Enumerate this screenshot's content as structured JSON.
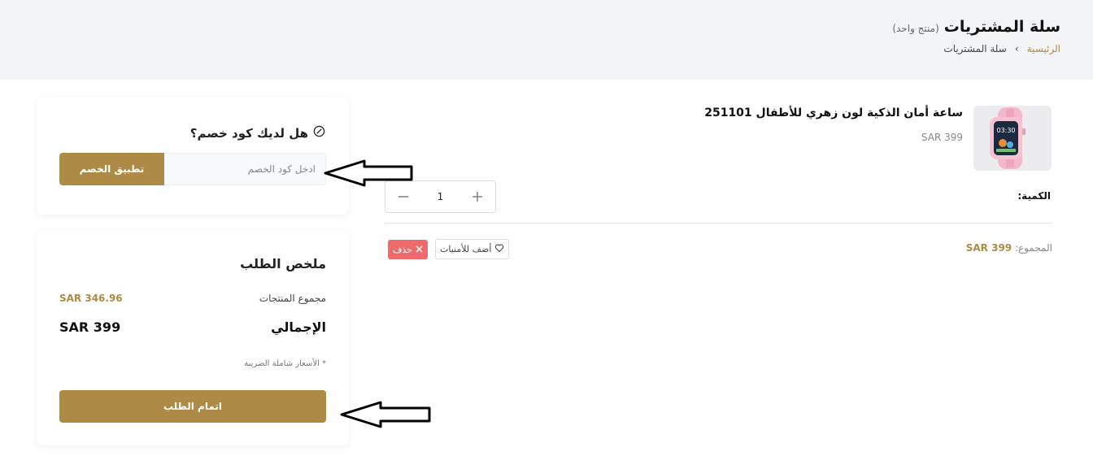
{
  "header": {
    "title": "سلة المشتريات",
    "count": "(منتج واحد)",
    "breadcrumb": {
      "home": "الرئيسية",
      "separator": "›",
      "current": "سلة المشتريات"
    }
  },
  "coupon": {
    "title": "هل لديك كود خصم؟",
    "placeholder": "ادخل كود الخصم",
    "apply_label": "تطبيق الخصم"
  },
  "summary": {
    "title": "ملخص الطلب",
    "products_label": "مجموع المنتجات",
    "products_value": "SAR 346.96",
    "total_label": "الإجمالي",
    "total_value": "SAR 399",
    "tax_note": "* الأسعار شاملة الضريبة",
    "checkout_label": "اتمام الطلب"
  },
  "cart_item": {
    "name": "ساعة أمان الذكية لون زهري للأطفال 251101",
    "price": "SAR 399",
    "quantity_label": "الكمية:",
    "quantity": "1",
    "total_label": "المجموع:",
    "total_value": "SAR 399",
    "wishlist_label": "أضف للأمنيات",
    "delete_label": "حذف",
    "thumb_time": "03:30"
  },
  "colors": {
    "accent": "#ad8b47",
    "danger": "#ef6b6b",
    "header_bg": "#f3f4f6"
  }
}
